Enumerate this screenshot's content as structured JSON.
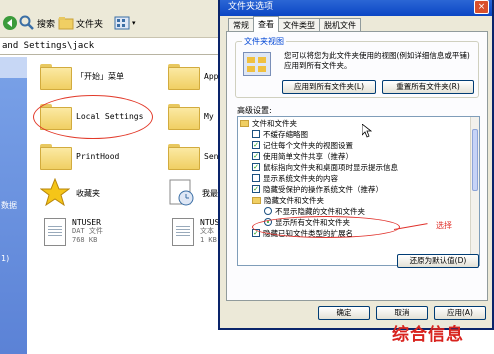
{
  "explorer": {
    "toolbar": {
      "search_label": "搜索",
      "folders_label": "文件夹"
    },
    "address": "and Settings\\jack",
    "taskpane": {
      "label_1": "数据",
      "label_2": "1)"
    },
    "items": [
      {
        "name": "「开始」菜单"
      },
      {
        "name": "Appl"
      },
      {
        "name": "Local Settings"
      },
      {
        "name": "My D"
      },
      {
        "name": "PrintHood"
      },
      {
        "name": "Send"
      },
      {
        "name": "收藏夹"
      },
      {
        "name": "我最"
      },
      {
        "name": "NTUSER",
        "line2": "DAT 文件",
        "line3": "768 KB"
      },
      {
        "name": "NTUS",
        "line2": "文本",
        "line3": "1 KB"
      }
    ]
  },
  "dialog": {
    "title": "文件夹选项",
    "close_glyph": "×",
    "tabs": [
      "常规",
      "查看",
      "文件类型",
      "脱机文件"
    ],
    "active_tab": 1,
    "views_group": {
      "title": "文件夹视图",
      "description": "您可以将您为此文件夹使用的视图(例如详细信息或平铺)应用到所有文件夹。",
      "apply_all": "应用到所有文件夹(L)",
      "reset_all": "重置所有文件夹(R)"
    },
    "advanced_label": "高级设置:",
    "settings": [
      {
        "kind": "folder",
        "label": "文件和文件夹"
      },
      {
        "kind": "check",
        "checked": false,
        "label": "不缓存缩略图"
      },
      {
        "kind": "check",
        "checked": true,
        "label": "记住每个文件夹的视图设置"
      },
      {
        "kind": "check",
        "checked": true,
        "label": "使用简单文件共享（推荐）"
      },
      {
        "kind": "check",
        "checked": true,
        "label": "鼠标指向文件夹和桌面项时显示提示信息"
      },
      {
        "kind": "check",
        "checked": false,
        "label": "显示系统文件夹的内容"
      },
      {
        "kind": "check",
        "checked": true,
        "label": "隐藏受保护的操作系统文件（推荐）"
      },
      {
        "kind": "folder",
        "label": "隐藏文件和文件夹"
      },
      {
        "kind": "radio",
        "checked": false,
        "label": "不显示隐藏的文件和文件夹"
      },
      {
        "kind": "radio",
        "checked": true,
        "label": "显示所有文件和文件夹"
      },
      {
        "kind": "check",
        "checked": true,
        "label": "隐藏已知文件类型的扩展名"
      }
    ],
    "restore_defaults": "还原为默认值(D)",
    "ok_label": "确定",
    "cancel_label": "取消",
    "apply_label": "应用(A)"
  },
  "annotation": "选择",
  "watermark": "综合信息",
  "colors": {
    "title_bar": "#0b46c4",
    "annotation": "#e0302a",
    "watermark": "#d8231e",
    "tab_text_blue": "#0046d5"
  }
}
